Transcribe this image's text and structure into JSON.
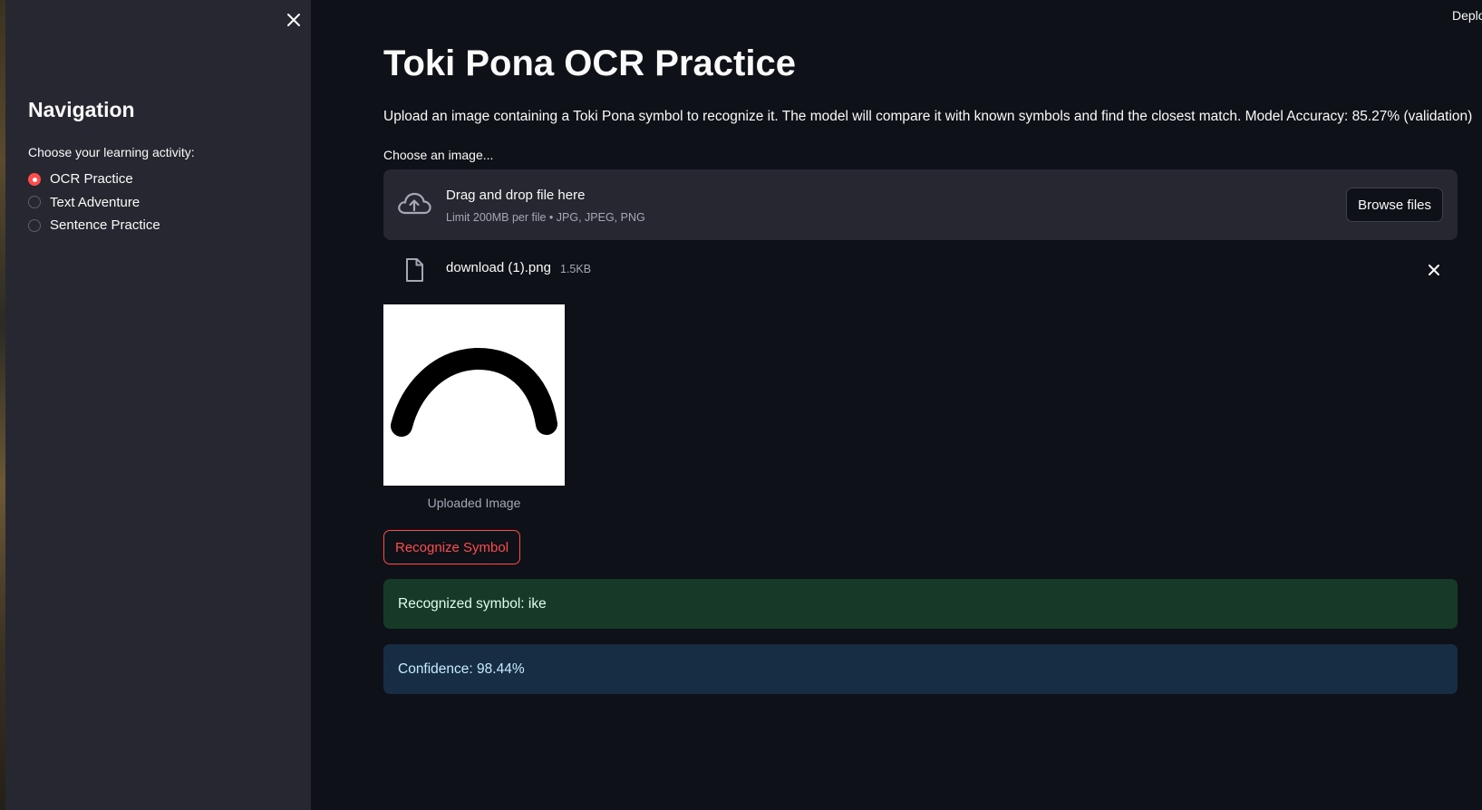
{
  "app": {
    "deploy_label": "Deploy"
  },
  "sidebar": {
    "title": "Navigation",
    "radio_label": "Choose your learning activity:",
    "options": [
      {
        "label": "OCR Practice",
        "selected": true
      },
      {
        "label": "Text Adventure",
        "selected": false
      },
      {
        "label": "Sentence Practice",
        "selected": false
      }
    ],
    "close_icon": "close-icon"
  },
  "main": {
    "title": "Toki Pona OCR Practice",
    "description": "Upload an image containing a Toki Pona symbol to recognize it. The model will compare it with known symbols and find the closest match. Model Accuracy: 85.27% (validation)",
    "uploader": {
      "label": "Choose an image...",
      "drop_text": "Drag and drop file here",
      "limit_text": "Limit 200MB per file • JPG, JPEG, PNG",
      "browse_label": "Browse files",
      "icon": "cloud-upload-icon"
    },
    "file": {
      "name": "download (1).png",
      "size": "1.5KB",
      "icon": "file-icon"
    },
    "image_caption": "Uploaded Image",
    "recognize_label": "Recognize Symbol",
    "result_text": "Recognized symbol: ike",
    "confidence_text": "Confidence: 98.44%"
  },
  "colors": {
    "background": "#0e1117",
    "sidebar": "#262730",
    "accent": "#ff4b4b",
    "success_bg": "#173928",
    "info_bg": "#172d43"
  }
}
